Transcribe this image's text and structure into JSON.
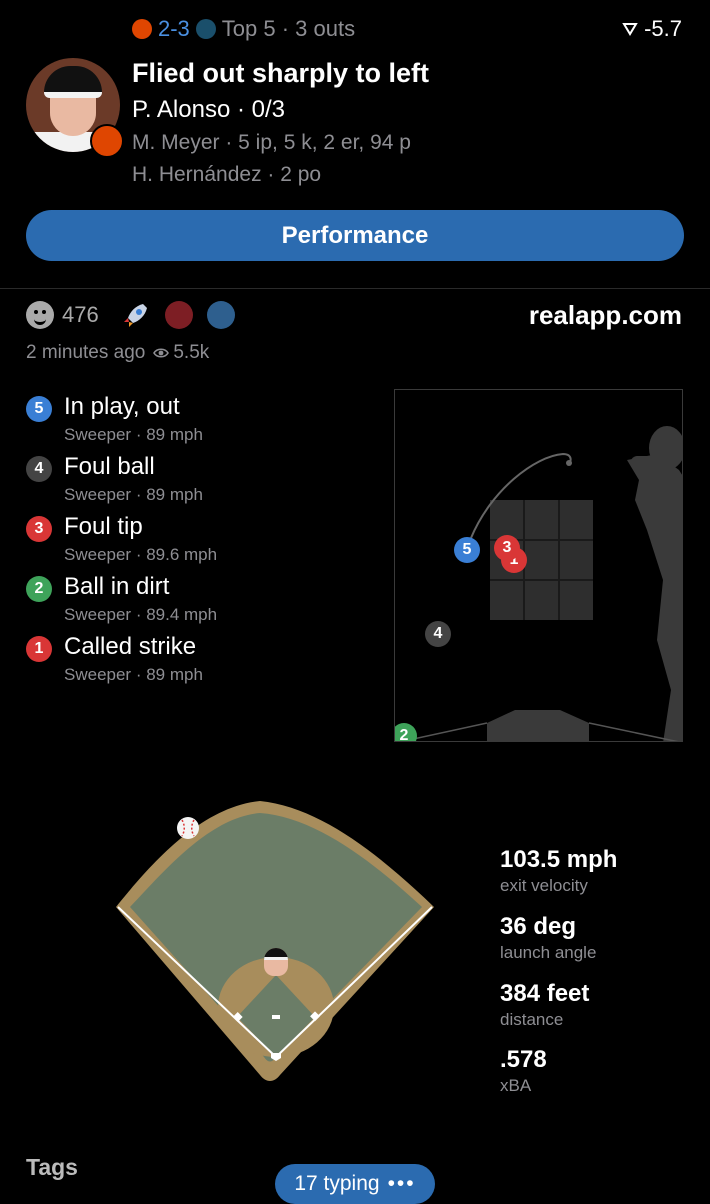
{
  "header": {
    "score": "2-3",
    "inning": "Top 5 · 3 outs",
    "win_prob_change": "-5.7",
    "headline": "Flied out sharply to left",
    "batter": "P. Alonso · 0/3",
    "pitcher": "M. Meyer · 5 ip, 5 k, 2 er, 94 p",
    "fielder": "H. Hernández · 2 po"
  },
  "performance_button": "Performance",
  "social": {
    "reaction_count": "476",
    "site": "realapp.com",
    "time_ago": "2 minutes ago",
    "views": "5.5k"
  },
  "pitches": [
    {
      "num": "5",
      "result": "In play, out",
      "detail": "Sweeper · 89 mph",
      "color": "#3a7fd5"
    },
    {
      "num": "4",
      "result": "Foul ball",
      "detail": "Sweeper · 89 mph",
      "color": "#444444"
    },
    {
      "num": "3",
      "result": "Foul tip",
      "detail": "Sweeper · 89.6 mph",
      "color": "#d93636"
    },
    {
      "num": "2",
      "result": "Ball in dirt",
      "detail": "Sweeper · 89.4 mph",
      "color": "#3ea35a"
    },
    {
      "num": "1",
      "result": "Called strike",
      "detail": "Sweeper · 89 mph",
      "color": "#d93636"
    }
  ],
  "zone_markers": [
    {
      "label": "5",
      "color": "#3a7fd5"
    },
    {
      "label": "3",
      "color": "#d93636"
    },
    {
      "label": "1",
      "color": "#d93636"
    },
    {
      "label": "4",
      "color": "#444444"
    },
    {
      "label": "2",
      "color": "#3ea35a"
    }
  ],
  "batted_ball": {
    "exit_velocity": "103.5 mph",
    "exit_velocity_label": "exit velocity",
    "launch_angle": "36 deg",
    "launch_angle_label": "launch angle",
    "distance": "384 feet",
    "distance_label": "distance",
    "xba": ".578",
    "xba_label": "xBA"
  },
  "footer": {
    "tags": "Tags",
    "typing": "17 typing"
  },
  "colors": {
    "accent": "#2b6bb0",
    "orioles": "#df4601",
    "grass": "#6b7d67",
    "dirt": "#a88d5c"
  }
}
